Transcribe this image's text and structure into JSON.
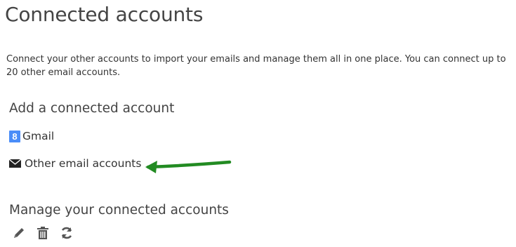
{
  "header": {
    "title": "Connected accounts"
  },
  "intro": {
    "text": "Connect your other accounts to import your emails and manage them all in one place. You can connect up to 20 other email accounts."
  },
  "add_section": {
    "title": "Add a connected account",
    "gmail_label": "Gmail",
    "gmail_icon": "gmail-icon",
    "gmail_icon_glyph": "8",
    "other_label": "Other email accounts",
    "other_icon": "envelope-icon"
  },
  "annotation": {
    "arrow_color": "#228b22"
  },
  "manage_section": {
    "title": "Manage your connected accounts",
    "tools": [
      "edit-icon",
      "trash-icon",
      "refresh-icon"
    ]
  }
}
